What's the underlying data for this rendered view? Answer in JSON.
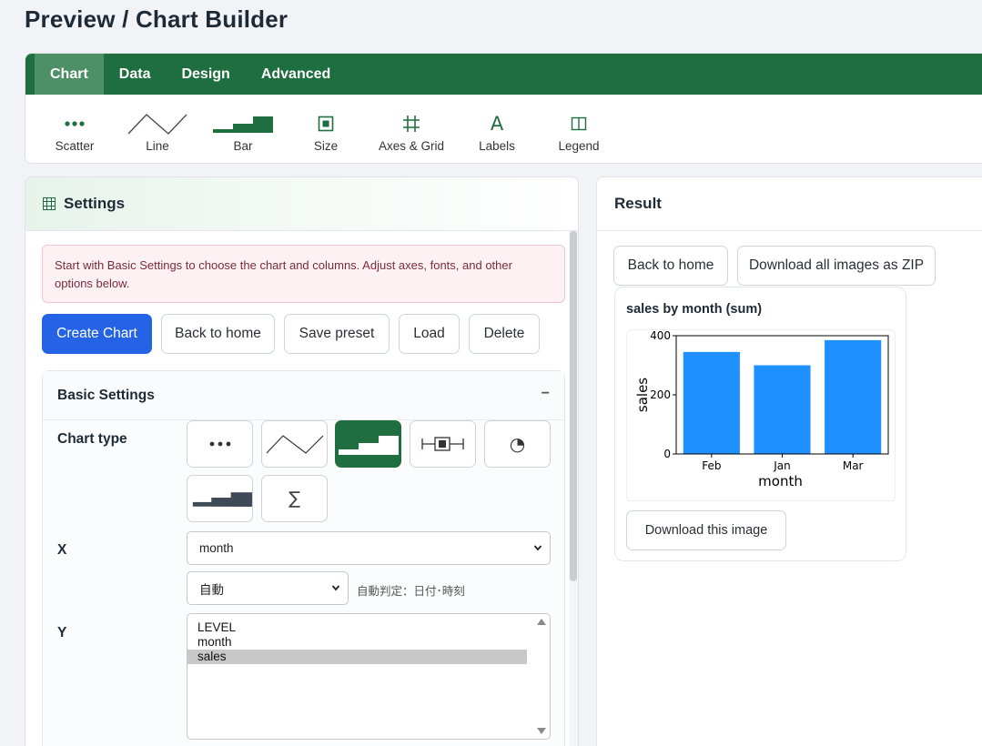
{
  "page": {
    "title": "Preview / Chart Builder"
  },
  "ribbon": {
    "tabs": [
      {
        "label": "Chart",
        "active": true
      },
      {
        "label": "Data",
        "active": false
      },
      {
        "label": "Design",
        "active": false
      },
      {
        "label": "Advanced",
        "active": false
      }
    ],
    "tools": [
      {
        "label": "Scatter",
        "icon": "scatter-icon"
      },
      {
        "label": "Line",
        "icon": "line-icon"
      },
      {
        "label": "Bar",
        "icon": "bar-icon"
      },
      {
        "label": "Size",
        "icon": "size-icon"
      },
      {
        "label": "Axes & Grid",
        "icon": "axes-grid-icon"
      },
      {
        "label": "Labels",
        "icon": "labels-icon",
        "glyph": "A"
      },
      {
        "label": "Legend",
        "icon": "legend-icon"
      }
    ]
  },
  "settings": {
    "title": "Settings",
    "alert": "Start with Basic Settings to choose the chart and columns. Adjust axes, fonts, and other options below.",
    "buttons": {
      "create": "Create Chart",
      "back": "Back to home",
      "save": "Save preset",
      "load": "Load",
      "delete": "Delete"
    },
    "basic": {
      "title": "Basic Settings",
      "toggle": "−",
      "chart_type_label": "Chart type",
      "chart_types": [
        {
          "name": "scatter",
          "selected": false
        },
        {
          "name": "line",
          "selected": false
        },
        {
          "name": "bar",
          "selected": true
        },
        {
          "name": "box",
          "selected": false
        },
        {
          "name": "pie",
          "selected": false,
          "glyph": "◔"
        },
        {
          "name": "histogram",
          "selected": false
        },
        {
          "name": "aggregate",
          "selected": false,
          "glyph": "∑"
        }
      ],
      "x_label": "X",
      "x_value": "month",
      "x_type_value": "自動",
      "x_type_hint": "自動判定：日付･時刻",
      "y_label": "Y",
      "y_options": [
        {
          "label": "LEVEL",
          "selected": false
        },
        {
          "label": "month",
          "selected": false
        },
        {
          "label": "sales",
          "selected": true
        }
      ]
    }
  },
  "result": {
    "title": "Result",
    "back": "Back to home",
    "download_zip": "Download all images as ZIP",
    "card_title": "sales by month (sum)",
    "download_image": "Download this image"
  },
  "colors": {
    "brand": "#1f6e3f",
    "primary": "#2463e6",
    "bar": "#1e90ff"
  },
  "chart_data": {
    "type": "bar",
    "categories": [
      "Feb",
      "Jan",
      "Mar"
    ],
    "values": [
      345,
      300,
      385
    ],
    "xlabel": "month",
    "ylabel": "sales",
    "ylim": [
      0,
      400
    ],
    "yticks": [
      0,
      200,
      400
    ],
    "grid": false
  }
}
